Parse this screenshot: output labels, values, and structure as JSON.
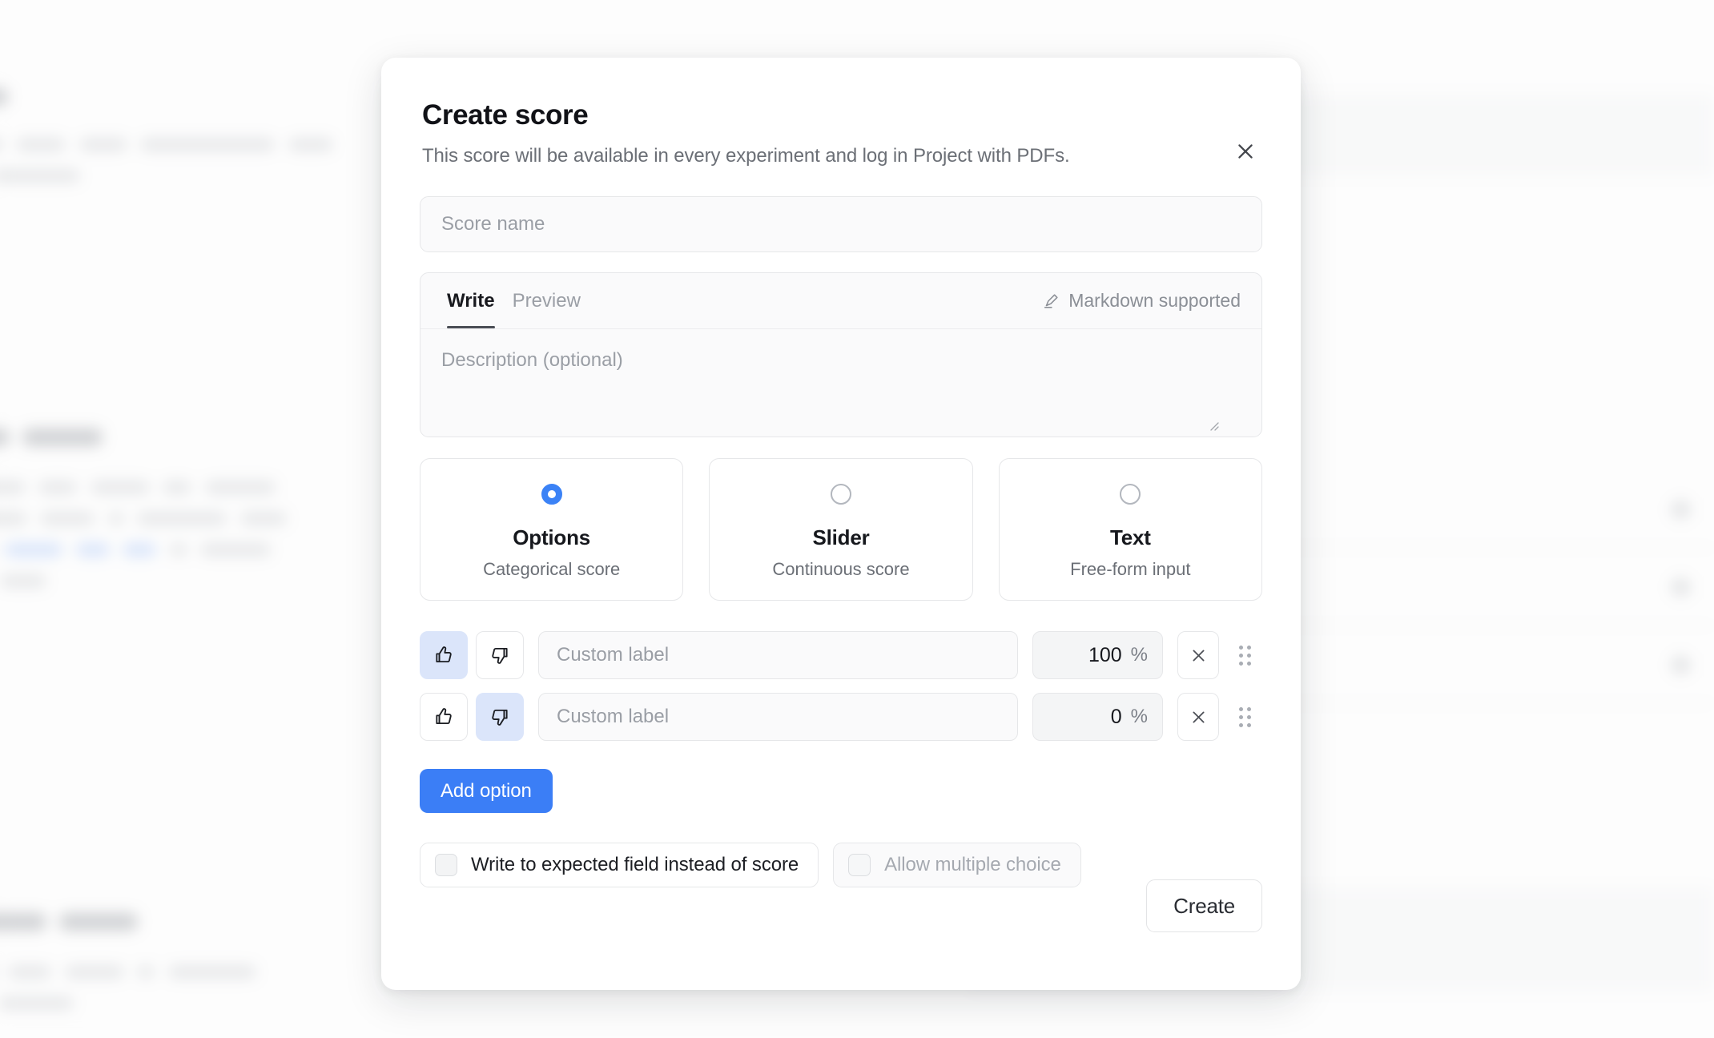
{
  "dialog": {
    "title": "Create score",
    "subtitle": "This score will be available in every experiment and log in Project with PDFs.",
    "close_icon": "close-icon",
    "score_name_placeholder": "Score name",
    "editor": {
      "tabs": [
        {
          "label": "Write",
          "active": true
        },
        {
          "label": "Preview",
          "active": false
        }
      ],
      "markdown_note": "Markdown supported",
      "markdown_icon": "pen-icon",
      "description_placeholder": "Description (optional)"
    },
    "score_types": [
      {
        "title": "Options",
        "subtitle": "Categorical score",
        "selected": true
      },
      {
        "title": "Slider",
        "subtitle": "Continuous score",
        "selected": false
      },
      {
        "title": "Text",
        "subtitle": "Free-form input",
        "selected": false
      }
    ],
    "options": [
      {
        "vote": "up",
        "label_value": "",
        "label_placeholder": "Custom label",
        "percent": "100",
        "percent_symbol": "%",
        "remove_icon": "close-icon",
        "drag_icon": "drag-handle-icon"
      },
      {
        "vote": "down",
        "label_value": "",
        "label_placeholder": "Custom label",
        "percent": "0",
        "percent_symbol": "%",
        "remove_icon": "close-icon",
        "drag_icon": "drag-handle-icon"
      }
    ],
    "add_option_label": "Add option",
    "checkboxes": [
      {
        "label": "Write to expected field instead of score",
        "checked": false,
        "disabled": false
      },
      {
        "label": "Allow multiple choice",
        "checked": false,
        "disabled": true
      }
    ],
    "create_label": "Create"
  },
  "colors": {
    "accent_blue": "#3b7ef6",
    "radio_blue": "#3b82f6",
    "vote_active_bg": "#dbe5fa",
    "border": "#e6e7e9",
    "field_bg": "#fafafb",
    "text_primary": "#16181d",
    "text_muted": "#6b6f76",
    "placeholder": "#9a9ea5"
  },
  "background": {
    "note": "blurred underlying page",
    "left_column_blocks": 4,
    "right_table_rows": 3
  }
}
